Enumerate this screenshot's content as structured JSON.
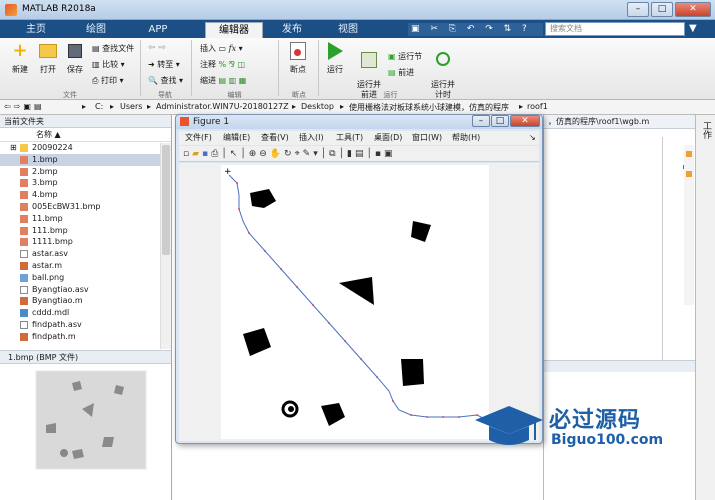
{
  "window": {
    "title": "MATLAB R2018a"
  },
  "tabs": [
    "主页",
    "绘图",
    "APP",
    "编辑器",
    "发布",
    "视图"
  ],
  "search": {
    "placeholder": "搜索文档"
  },
  "ribbon": {
    "file": {
      "new": "新建",
      "open": "打开",
      "save": "保存",
      "find_files": "查找文件",
      "compare": "比较",
      "print": "打印",
      "group": "文件"
    },
    "nav": {
      "goto": "转至",
      "find": "查找",
      "group": "导航"
    },
    "edit": {
      "insert": "插入",
      "comment": "注释",
      "indent": "缩进",
      "fx": "fx",
      "group": "编辑"
    },
    "breakpoints": {
      "label": "断点",
      "group": "断点"
    },
    "run": {
      "run": "运行",
      "run_advance": "运行并\n前进",
      "run_section": "运行节",
      "advance": "前进",
      "run_time": "运行并\n计时",
      "group": "运行"
    }
  },
  "address": {
    "parts": [
      "C:",
      "Users",
      "Administrator.WIN7U-20180127Z",
      "Desktop",
      "使用栅格法对板球系统小球建模，仿真的程序",
      "roof1"
    ],
    "editor_path": "，仿真的程序\\roof1\\wgb.m"
  },
  "current_folder": {
    "title": "当前文件夹",
    "col_name": "名称 ▲",
    "files": [
      "20090224",
      "1.bmp",
      "2.bmp",
      "3.bmp",
      "4.bmp",
      "005EcBW31.bmp",
      "11.bmp",
      "111.bmp",
      "1111.bmp",
      "astar.asv",
      "astar.m",
      "ball.png",
      "Byangtiao.asv",
      "Byangtiao.m",
      "cddd.mdl",
      "findpath.asv",
      "findpath.m"
    ],
    "selected": "1.bmp"
  },
  "preview": {
    "title": "1.bmp  (BMP 文件)"
  },
  "workspace": {
    "title": "工作"
  },
  "figure": {
    "title": "Figure 1",
    "menu": [
      "文件(F)",
      "编辑(E)",
      "查看(V)",
      "插入(I)",
      "工具(T)",
      "桌面(D)",
      "窗口(W)",
      "帮助(H)"
    ],
    "start_marker": "+"
  },
  "watermark": {
    "main": "必过源码",
    "sub": "Biguo100.com"
  },
  "colors": {
    "ribbon_tab_bg": "#1b4f86",
    "path_line": "#4a6fc7",
    "path_dot": "#d0506a",
    "selected": "#c8d4e4"
  }
}
